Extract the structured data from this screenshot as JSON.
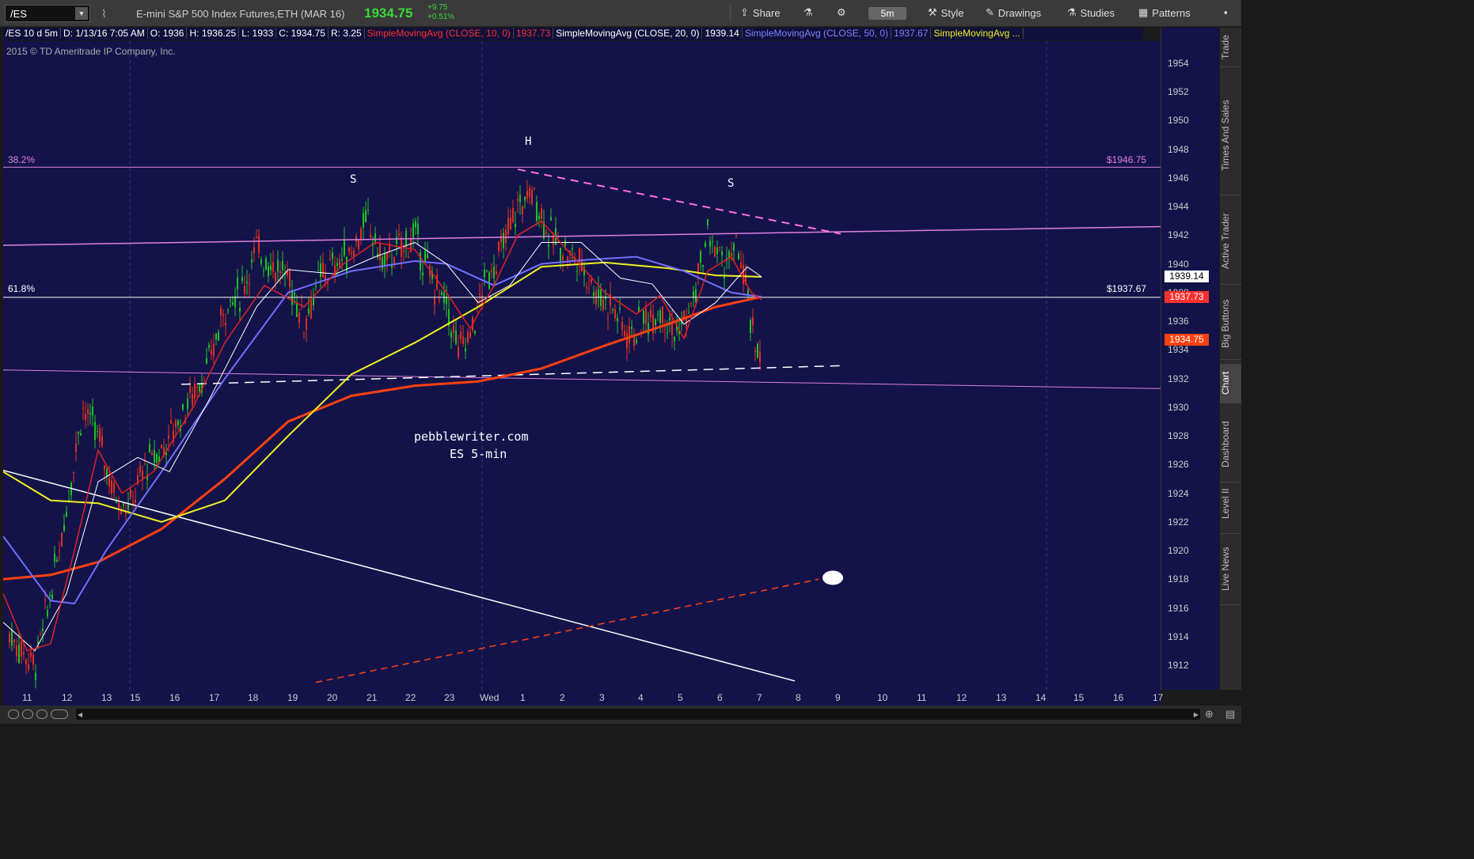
{
  "toolbar": {
    "symbol": "/ES",
    "instrument": "E-mini S&P 500 Index Futures,ETH (MAR 16)",
    "last_price": "1934.75",
    "change_abs": "+9.75",
    "change_pct": "+0.51%",
    "share_label": "Share",
    "timeframe": "5m",
    "style_label": "Style",
    "drawings_label": "Drawings",
    "studies_label": "Studies",
    "patterns_label": "Patterns"
  },
  "studybar": {
    "chart_desc": "/ES 10 d 5m",
    "date": "D: 1/13/16 7:05 AM",
    "open": "O: 1936",
    "high": "H: 1936.25",
    "low": "L: 1933",
    "close": "C: 1934.75",
    "range": "R: 3.25",
    "sma10_label": "SimpleMovingAvg (CLOSE, 10, 0)",
    "sma10_value": "1937.73",
    "sma20_label": "SimpleMovingAvg (CLOSE, 20, 0)",
    "sma20_value": "1939.14",
    "sma50_label": "SimpleMovingAvg (CLOSE, 50, 0)",
    "sma50_value": "1937.67",
    "sma_more_label": "SimpleMovingAvg ..."
  },
  "copyright": "2015 © TD Ameritrade IP Company, Inc.",
  "annotations": {
    "fib_382": "38.2%",
    "fib_382_price": "$1946.75",
    "fib_618": "61.8%",
    "fib_618_price": "$1937.67",
    "left_shoulder": "S",
    "head": "H",
    "right_shoulder": "S",
    "watermark_1": "pebblewriter.com",
    "watermark_2": "ES 5-min"
  },
  "price_axis": {
    "ticks": [
      "1954",
      "1952",
      "1950",
      "1948",
      "1946",
      "1944",
      "1942",
      "1940",
      "1938",
      "1936",
      "1934",
      "1932",
      "1930",
      "1928",
      "1926",
      "1924",
      "1922",
      "1920",
      "1918",
      "1916",
      "1914",
      "1912"
    ],
    "badge_sma20": "1939.14",
    "badge_sma10": "1937.73",
    "badge_last": "1934.75"
  },
  "time_axis": {
    "ticks": [
      "11",
      "12",
      "13",
      "15",
      "16",
      "17",
      "18",
      "19",
      "20",
      "21",
      "22",
      "23",
      "Wed",
      "1",
      "2",
      "3",
      "4",
      "5",
      "6",
      "7",
      "8",
      "9",
      "10",
      "11",
      "12",
      "13",
      "14",
      "15",
      "16",
      "17"
    ]
  },
  "side_tabs": [
    "Trade",
    "Times And Sales",
    "Active Trader",
    "Big Buttons",
    "Chart",
    "Dashboard",
    "Level II",
    "Live News"
  ],
  "colors": {
    "background": "#13134a",
    "sma10": "#e02020",
    "sma20": "#ffffff",
    "sma50": "#7070ff",
    "sma_yellow": "#f0f020",
    "sma_orange": "#ff4010",
    "fib": "#e080e0",
    "up_candle": "#20c020",
    "down_candle": "#e03020"
  },
  "chart_data": {
    "type": "candlestick",
    "ylim": [
      1910.5,
      1955.5
    ],
    "levels": [
      {
        "name": "38.2%",
        "price": 1946.75
      },
      {
        "name": "61.8%",
        "price": 1937.67
      }
    ],
    "series": [
      {
        "name": "SimpleMovingAvg (CLOSE, 10, 0)",
        "last": 1937.73
      },
      {
        "name": "SimpleMovingAvg (CLOSE, 20, 0)",
        "last": 1939.14
      },
      {
        "name": "SimpleMovingAvg (CLOSE, 50, 0)",
        "last": 1937.67
      }
    ],
    "last_price": 1934.75
  }
}
